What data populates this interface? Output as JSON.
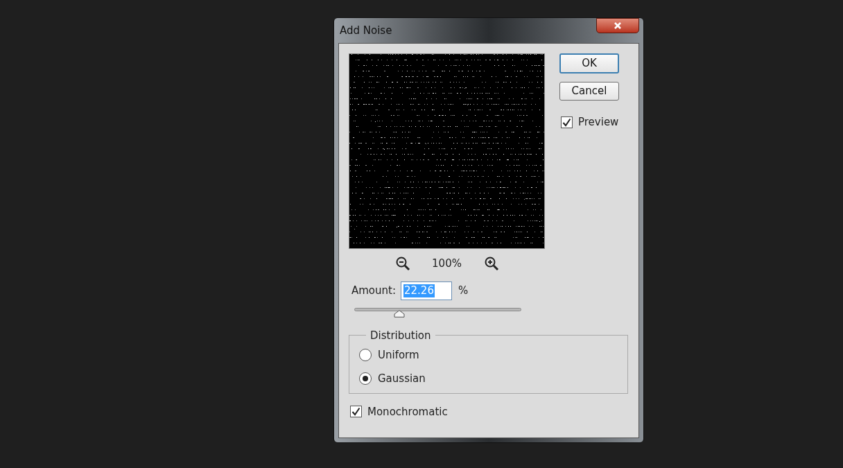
{
  "window": {
    "title": "Add Noise"
  },
  "buttons": [
    {
      "label": "OK",
      "default": true
    },
    {
      "label": "Cancel",
      "default": false
    }
  ],
  "preview": {
    "label": "Preview",
    "checked": true
  },
  "zoom": {
    "reading": "100%"
  },
  "amount": {
    "label": "Amount:",
    "value": "22.26",
    "unit": "%",
    "level": 0.27
  },
  "distribution": {
    "title": "Distribution",
    "options": [
      {
        "label": "Uniform",
        "selected": false
      },
      {
        "label": "Gaussian",
        "selected": true
      }
    ]
  },
  "monochromatic": {
    "label": "Monochromatic",
    "checked": true
  }
}
